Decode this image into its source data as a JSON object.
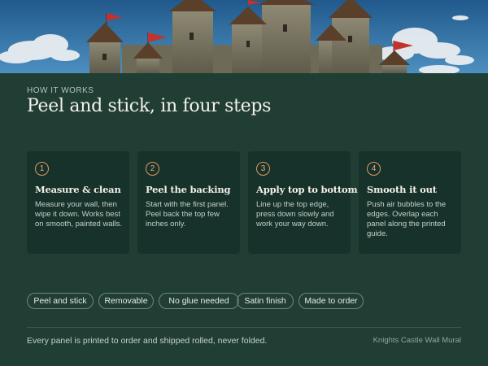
{
  "section": {
    "eyebrow": "HOW IT WORKS",
    "title": "Peel and stick, in four steps"
  },
  "steps": [
    {
      "number": "1",
      "title": "Measure & clean",
      "body": "Measure your wall, then wipe it down. Works best on smooth, painted walls."
    },
    {
      "number": "2",
      "title": "Peel the backing",
      "body": "Start with the first panel. Peel back the top few inches only."
    },
    {
      "number": "3",
      "title": "Apply top to bottom",
      "body": "Line up the top edge, press down slowly and work your way down."
    },
    {
      "number": "4",
      "title": "Smooth it out",
      "body": "Push air bubbles to the edges. Overlap each panel along the printed guide."
    }
  ],
  "tags": [
    "Peel and stick",
    "Removable",
    "No glue needed",
    "Satin finish",
    "Made to order"
  ],
  "footer": {
    "note": "Every panel is printed to order and shipped rolled, never folded.",
    "product": "Knights Castle Wall Mural"
  },
  "colors": {
    "background": "#213e34",
    "card": "#17322a",
    "accent": "#d99b62",
    "sky": "#2f6fa3"
  }
}
